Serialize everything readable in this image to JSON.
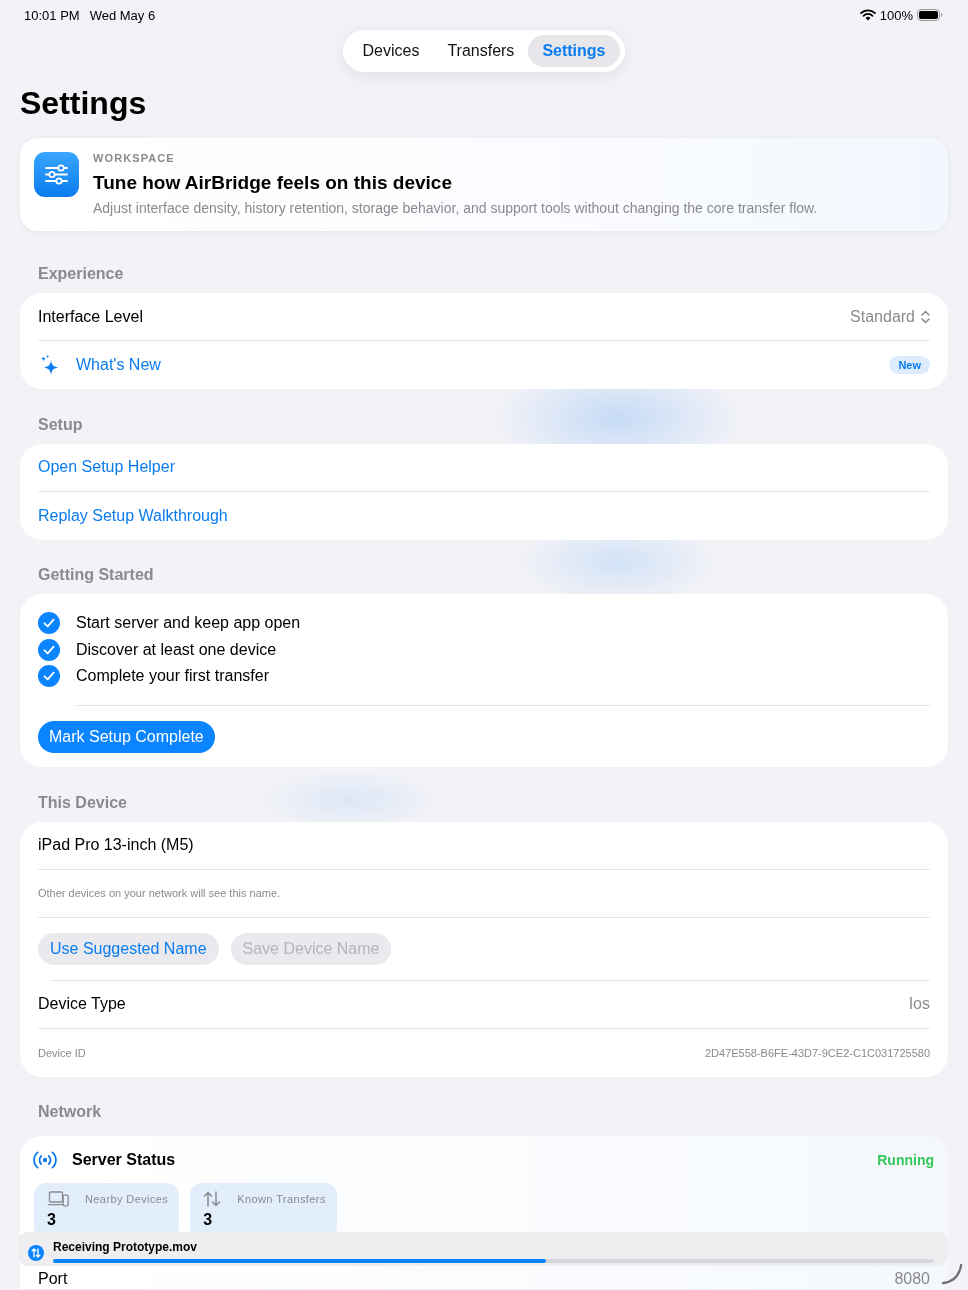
{
  "status_bar": {
    "time": "10:01 PM",
    "date": "Wed May 6",
    "battery": "100%"
  },
  "tabs": [
    {
      "label": "Devices",
      "selected": false
    },
    {
      "label": "Transfers",
      "selected": false
    },
    {
      "label": "Settings",
      "selected": true
    }
  ],
  "title": "Settings",
  "header_card": {
    "eyebrow": "WORKSPACE",
    "title": "Tune how AirBridge feels on this device",
    "description": "Adjust interface density, history retention, storage behavior, and support tools without changing the core transfer flow."
  },
  "experience": {
    "title": "Experience",
    "interface_level": {
      "label": "Interface Level",
      "value": "Standard"
    },
    "whats_new": {
      "label": "What's New",
      "badge": "New"
    }
  },
  "setup": {
    "title": "Setup",
    "links": [
      "Open Setup Helper",
      "Replay Setup Walkthrough"
    ]
  },
  "getting_started": {
    "title": "Getting Started",
    "steps": [
      {
        "label": "Start server and keep app open",
        "checked": true
      },
      {
        "label": "Discover at least one device",
        "checked": true
      },
      {
        "label": "Complete your first transfer",
        "checked": true
      }
    ],
    "button": "Mark Setup Complete"
  },
  "this_device": {
    "title": "This Device",
    "name_field": {
      "value": "iPad Pro 13-inch (M5)"
    },
    "hint": "Other devices on your network will see this name.",
    "buttons": [
      {
        "label": "Use Suggested Name",
        "disabled": false
      },
      {
        "label": "Save Device Name",
        "disabled": true
      }
    ],
    "device_type": {
      "label": "Device Type",
      "value": "Ios"
    },
    "device_id": {
      "label": "Device ID",
      "value": "2D47E558-B6FE-43D7-9CE2-C1C031725580"
    }
  },
  "network": {
    "title": "Network",
    "server_status": {
      "label": "Server Status",
      "value": "Running"
    },
    "stats": [
      {
        "kind": "devices",
        "label": "Nearby Devices",
        "value": "3"
      },
      {
        "kind": "transfers",
        "label": "Known Transfers",
        "value": "3"
      }
    ],
    "port": {
      "label": "Port",
      "value": "8080"
    }
  },
  "transfer_banner": {
    "label": "Receiving Prototype.mov",
    "level": 0.56
  }
}
